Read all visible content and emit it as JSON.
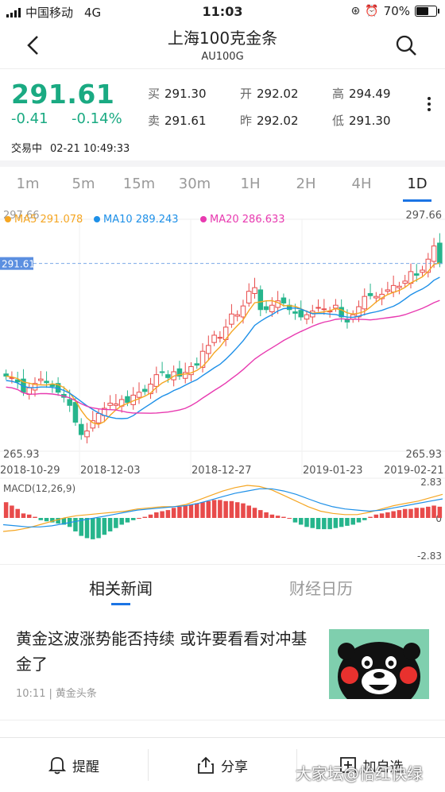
{
  "status_bar": {
    "carrier": "中国移动",
    "network": "4G",
    "time": "11:03",
    "battery": "70%",
    "battery_level": 0.7
  },
  "nav": {
    "title": "上海100克金条",
    "subtitle": "AU100G"
  },
  "quote": {
    "price": "291.61",
    "change": "-0.41",
    "change_pct": "-0.14%",
    "buy_label": "买",
    "buy": "291.30",
    "sell_label": "卖",
    "sell": "291.61",
    "open_label": "开",
    "open": "292.02",
    "prev_label": "昨",
    "prev": "292.02",
    "high_label": "高",
    "high": "294.49",
    "low_label": "低",
    "low": "291.30",
    "status": "交易中",
    "datetime": "02-21 10:49:33"
  },
  "period_tabs": [
    "1m",
    "5m",
    "15m",
    "30m",
    "1H",
    "2H",
    "4H",
    "1D"
  ],
  "active_period": "1D",
  "chart_data": {
    "type": "candlestick",
    "ylim": [
      265.93,
      297.66
    ],
    "max_label": "297.66",
    "min_label": "265.93",
    "current_price_label": "291.61",
    "current_price": 291.61,
    "x_ticks": [
      "2018-10-29",
      "2018-12-03",
      "2018-12-27",
      "2019-01-23",
      "2019-02-21"
    ],
    "legend": [
      {
        "name": "MA5",
        "value": "291.078",
        "color": "#f5a623"
      },
      {
        "name": "MA10",
        "value": "289.243",
        "color": "#1e90e8"
      },
      {
        "name": "MA20",
        "value": "286.633",
        "color": "#e83ab0"
      }
    ],
    "up_color": "#e84b4b",
    "down_color": "#26b58c",
    "close": [
      276.2,
      276.0,
      275.4,
      274.0,
      274.6,
      275.2,
      275.8,
      275.3,
      274.8,
      274.0,
      273.3,
      272.2,
      269.9,
      268.2,
      268.7,
      270.1,
      271.1,
      271.8,
      272.5,
      272.4,
      273.0,
      272.6,
      273.6,
      274.0,
      274.1,
      275.1,
      276.4,
      276.7,
      276.0,
      276.8,
      276.2,
      276.7,
      277.5,
      277.7,
      279.6,
      280.4,
      281.8,
      281.5,
      282.9,
      284.7,
      284.6,
      285.8,
      287.8,
      288.3,
      285.3,
      285.3,
      285.9,
      286.5,
      286.2,
      285.3,
      284.8,
      284.3,
      284.6,
      285.1,
      285.6,
      285.4,
      285.1,
      285.9,
      284.3,
      283.6,
      284.6,
      285.7,
      287.1,
      287.2,
      287.1,
      287.4,
      288.0,
      288.6,
      288.5,
      289.2,
      290.5,
      290.0,
      290.7,
      292.2,
      294.0,
      291.6
    ]
  },
  "macd": {
    "label": "MACD(12,26,9)",
    "top_label": "2.83",
    "zero_label": "0",
    "bottom_label": "-2.83",
    "ylim": [
      -2.83,
      2.83
    ],
    "hist": [
      1.4,
      1.1,
      0.8,
      0.4,
      0.3,
      0.1,
      -0.2,
      -0.3,
      -0.4,
      -0.5,
      -0.6,
      -0.8,
      -1.2,
      -1.6,
      -1.8,
      -1.9,
      -1.8,
      -1.5,
      -1.2,
      -0.9,
      -0.6,
      -0.4,
      -0.2,
      0,
      0.1,
      0.3,
      0.5,
      0.6,
      0.7,
      0.9,
      1.0,
      1.1,
      1.2,
      1.3,
      1.4,
      1.5,
      1.6,
      1.6,
      1.5,
      1.5,
      1.4,
      1.3,
      1.1,
      0.9,
      0.7,
      0.5,
      0.3,
      0.2,
      0.1,
      0,
      -0.4,
      -0.6,
      -0.8,
      -0.9,
      -1.0,
      -1.0,
      -1.0,
      -0.9,
      -0.8,
      -0.7,
      -0.6,
      -0.4,
      -0.2,
      0.1,
      0.3,
      0.4,
      0.5,
      0.6,
      0.7,
      0.8,
      0.8,
      0.9,
      0.9,
      1.0,
      1.1,
      1.0
    ],
    "dif": [
      -1.2,
      -1.1,
      -0.9,
      -0.6,
      -0.3,
      0,
      0.2,
      0.3,
      0.4,
      0.5,
      0.6,
      0.8,
      0.9,
      1.0,
      1.0,
      1.2,
      1.6,
      2.0,
      2.4,
      2.7,
      2.9,
      2.8,
      2.5,
      2.0,
      1.5,
      1.0,
      0.6,
      0.4,
      0.3,
      0.3,
      0.5,
      0.8,
      1.1,
      1.3,
      1.5,
      1.8,
      2.1
    ],
    "dea": [
      -0.6,
      -0.7,
      -0.8,
      -0.8,
      -0.7,
      -0.5,
      -0.3,
      -0.1,
      0.1,
      0.3,
      0.5,
      0.7,
      0.8,
      0.9,
      1.0,
      1.1,
      1.3,
      1.6,
      1.9,
      2.2,
      2.4,
      2.6,
      2.6,
      2.4,
      2.1,
      1.7,
      1.3,
      1.0,
      0.8,
      0.7,
      0.6,
      0.7,
      0.9,
      1.1,
      1.3,
      1.5,
      1.7
    ],
    "dif_color": "#f5a623",
    "dea_color": "#1e90e8"
  },
  "news_tabs": {
    "related": "相关新闻",
    "calendar": "财经日历"
  },
  "news": [
    {
      "headline": "黄金这波涨势能否持续 或许要看看对冲基金了",
      "time": "10:11",
      "source": "黄金头条"
    }
  ],
  "bottom": {
    "remind": "提醒",
    "share": "分享",
    "watch": "加自选"
  },
  "watermark": "大家坛@怡红快绿"
}
